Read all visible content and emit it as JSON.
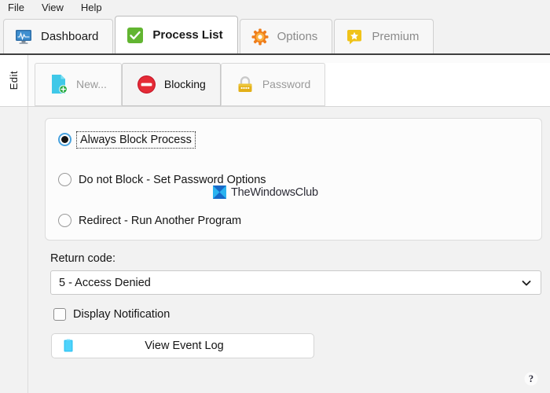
{
  "menu": {
    "items": [
      {
        "label": "File"
      },
      {
        "label": "View"
      },
      {
        "label": "Help"
      }
    ]
  },
  "tabs": [
    {
      "label": "Dashboard",
      "icon": "monitor-waveform-icon",
      "active": false
    },
    {
      "label": "Process List",
      "icon": "green-check-icon",
      "active": true
    },
    {
      "label": "Options",
      "icon": "gear-icon",
      "active": false
    },
    {
      "label": "Premium",
      "icon": "star-speech-bubble-icon",
      "active": false
    }
  ],
  "subnav": {
    "side_label": "Edit",
    "tabs": [
      {
        "label": "New...",
        "icon": "new-document-icon",
        "active": false
      },
      {
        "label": "Blocking",
        "icon": "no-entry-icon",
        "active": true
      },
      {
        "label": "Password",
        "icon": "padlock-icon",
        "active": false
      }
    ]
  },
  "blocking": {
    "options": [
      {
        "label": "Always Block Process",
        "selected": true,
        "focused": true
      },
      {
        "label": "Do not Block - Set Password Options",
        "selected": false,
        "focused": false
      },
      {
        "label": "Redirect - Run Another Program",
        "selected": false,
        "focused": false
      }
    ],
    "return_code": {
      "label": "Return code:",
      "value": "5 - Access Denied"
    },
    "display_notification": {
      "label": "Display Notification",
      "checked": false
    },
    "view_event_log": {
      "label": "View Event Log",
      "icon": "log-document-icon"
    }
  },
  "watermark": {
    "text": "TheWindowsClub",
    "logo": "thewindowsclub-logo"
  },
  "help": {
    "label": "?",
    "icon": "question-mark-icon"
  },
  "colors": {
    "accent_blue": "#4aa3df",
    "block_red": "#e02a2a",
    "check_green": "#62b531",
    "gear_orange": "#ef7d1a",
    "premium_yellow": "#f0c319",
    "padlock_gold": "#e3b018",
    "new_doc_cyan": "#3fc8e8",
    "log_cyan": "#35c6f4"
  }
}
